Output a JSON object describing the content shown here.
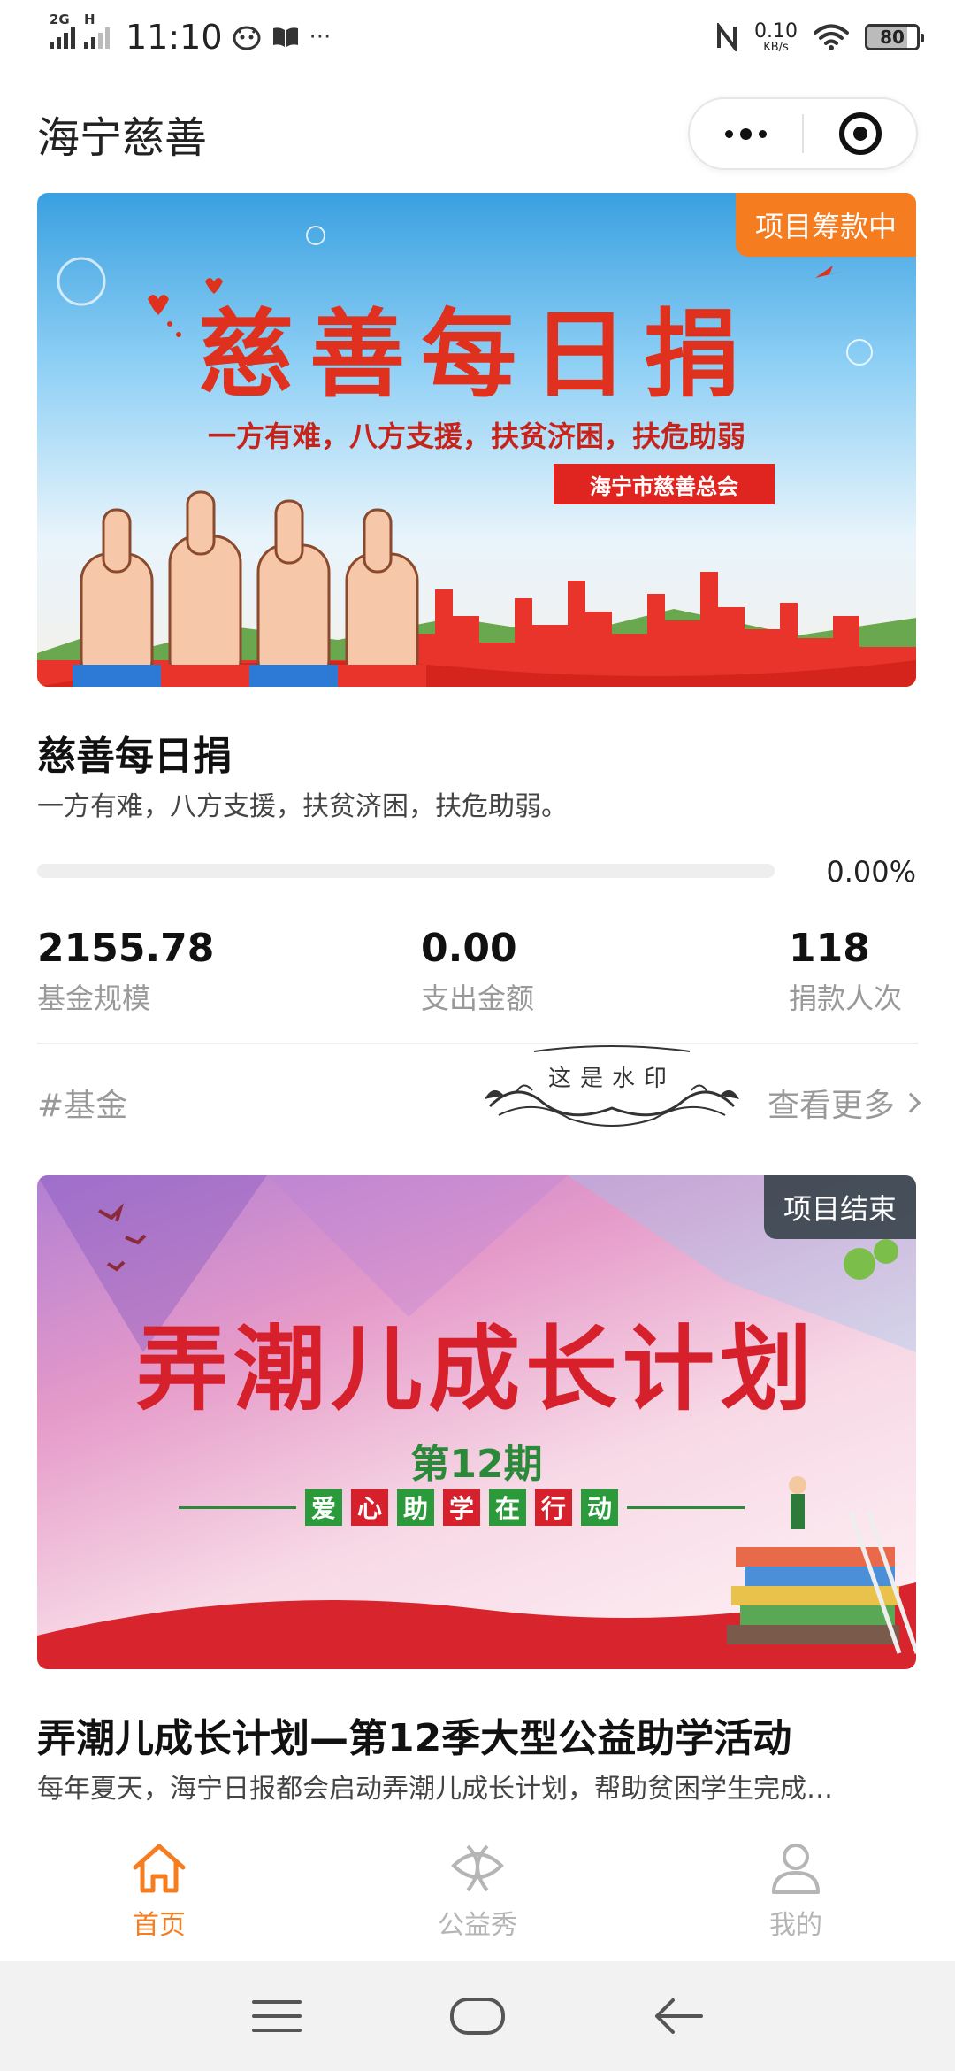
{
  "status_bar": {
    "signal1": "2G",
    "signal2": "H",
    "time": "11:10",
    "speed_value": "0.10",
    "speed_unit": "KB/s",
    "battery": "80"
  },
  "header": {
    "title": "海宁慈善"
  },
  "card1": {
    "badge": "项目筹款中",
    "banner_title": "慈善每日捐",
    "banner_subtitle": "一方有难，八方支援，扶贫济困，扶危助弱",
    "banner_tag": "海宁市慈善总会",
    "title": "慈善每日捐",
    "desc": "一方有难，八方支援，扶贫济困，扶危助弱。",
    "progress_value": 0.0,
    "progress_text": "0.00%",
    "stats": [
      {
        "value": "2155.78",
        "label": "基金规模"
      },
      {
        "value": "0.00",
        "label": "支出金额"
      },
      {
        "value": "118",
        "label": "捐款人次"
      }
    ],
    "tag": "#基金",
    "more": "查看更多",
    "watermark": "这是水印"
  },
  "card2": {
    "badge": "项目结束",
    "banner_title": "弄潮儿成长计划",
    "banner_issue": "第12期",
    "banner_chars": [
      "爱",
      "心",
      "助",
      "学",
      "在",
      "行",
      "动"
    ],
    "title": "弄潮儿成长计划—第12季大型公益助学活动",
    "desc": "每年夏天，海宁日报都会启动弄潮儿成长计划，帮助贫困学生完成…"
  },
  "tabbar": {
    "items": [
      {
        "label": "首页",
        "icon": "home-icon",
        "active": true
      },
      {
        "label": "公益秀",
        "icon": "charity-show-icon",
        "active": false
      },
      {
        "label": "我的",
        "icon": "user-icon",
        "active": false
      }
    ]
  },
  "colors": {
    "accent": "#f57c1f",
    "banner_red": "#e0301e",
    "muted": "#999999"
  }
}
